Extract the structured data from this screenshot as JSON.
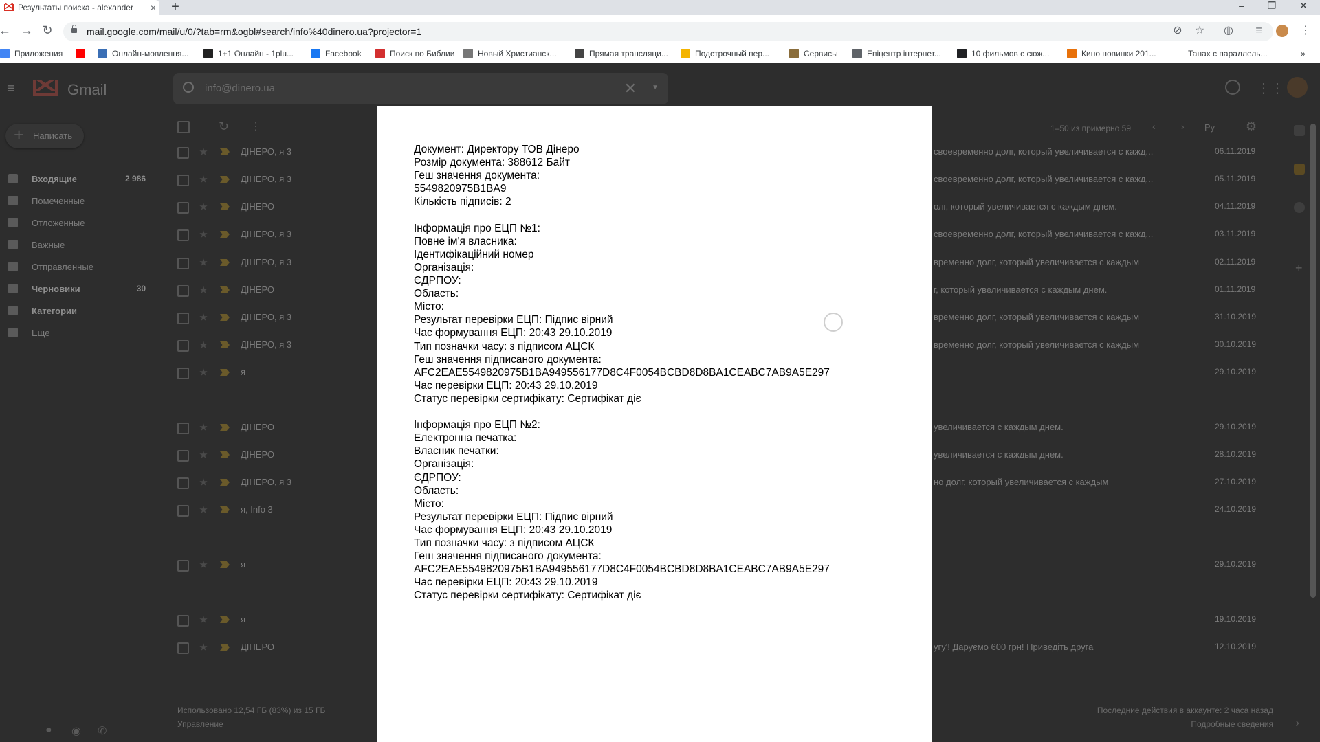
{
  "browser": {
    "tab_title": "Результаты поиска - alexander",
    "tab_close": "×",
    "new_tab": "+",
    "url": "mail.google.com/mail/u/0/?tab=rm&ogbl#search/info%40dinero.ua?projector=1",
    "bookmarks": [
      {
        "label": "Приложения",
        "color": "#4285f4"
      },
      {
        "label": "",
        "color": "#ff0000"
      },
      {
        "label": "Онлайн-мовлення...",
        "color": "#3b6fb5"
      },
      {
        "label": "1+1 Онлайн - 1plu...",
        "color": "#222222"
      },
      {
        "label": "Facebook",
        "color": "#1877f2"
      },
      {
        "label": "Поиск по Библии",
        "color": "#d32f2f"
      },
      {
        "label": "Новый Христианск...",
        "color": "#777777"
      },
      {
        "label": "Прямая трансляци...",
        "color": "#444444"
      },
      {
        "label": "Подстрочный пер...",
        "color": "#f4b400"
      },
      {
        "label": "Сервисы",
        "color": "#8a6d3b"
      },
      {
        "label": "Епіцентр інтернет...",
        "color": "#5f6368"
      },
      {
        "label": "10 фильмов с сюж...",
        "color": "#202124"
      },
      {
        "label": "Кино новинки 201...",
        "color": "#e8710a"
      },
      {
        "label": "Танах с параллель...",
        "color": "#ffffff"
      }
    ],
    "more_bookmarks": "»"
  },
  "gmail": {
    "app_name": "Gmail",
    "search_value": "info@dinero.ua",
    "compose": "Написать",
    "nav": [
      {
        "label": "Входящие",
        "count": "2 986",
        "bold": true
      },
      {
        "label": "Помеченные",
        "count": "",
        "bold": false
      },
      {
        "label": "Отложенные",
        "count": "",
        "bold": false
      },
      {
        "label": "Важные",
        "count": "",
        "bold": false
      },
      {
        "label": "Отправленные",
        "count": "",
        "bold": false
      },
      {
        "label": "Черновики",
        "count": "30",
        "bold": true
      },
      {
        "label": "Категории",
        "count": "",
        "bold": true
      },
      {
        "label": "Еще",
        "count": "",
        "bold": false
      }
    ],
    "pager": "1–50 из примерно 59",
    "lang": "Ру",
    "rows": [
      {
        "sender": "ДІНЕРО, я 3",
        "snippet": "своевременно долг, который увеличивается с кажд...",
        "date": "06.11.2019"
      },
      {
        "sender": "ДІНЕРО, я 3",
        "snippet": "своевременно долг, который увеличивается с кажд...",
        "date": "05.11.2019"
      },
      {
        "sender": "ДІНЕРО",
        "snippet": "олг, который увеличивается с каждым днем.",
        "date": "04.11.2019"
      },
      {
        "sender": "ДІНЕРО, я 3",
        "snippet": "своевременно долг, который увеличивается с кажд...",
        "date": "03.11.2019"
      },
      {
        "sender": "ДІНЕРО, я 3",
        "snippet": "временно долг, который увеличивается с каждым",
        "date": "02.11.2019"
      },
      {
        "sender": "ДІНЕРО",
        "snippet": "г, который увеличивается с каждым днем.",
        "date": "01.11.2019"
      },
      {
        "sender": "ДІНЕРО, я 3",
        "snippet": "временно долг, который увеличивается с каждым",
        "date": "31.10.2019"
      },
      {
        "sender": "ДІНЕРО, я 3",
        "snippet": "временно долг, который увеличивается с каждым",
        "date": "30.10.2019"
      },
      {
        "sender": "я",
        "snippet": "",
        "date": "29.10.2019"
      },
      {
        "sender": "ДІНЕРО",
        "snippet": "увеличивается с каждым днем.",
        "date": "29.10.2019"
      },
      {
        "sender": "ДІНЕРО",
        "snippet": "увеличивается с каждым днем.",
        "date": "28.10.2019"
      },
      {
        "sender": "ДІНЕРО, я 3",
        "snippet": "но долг, который увеличивается с каждым",
        "date": "27.10.2019"
      },
      {
        "sender": "я, Info 3",
        "snippet": "",
        "date": "24.10.2019"
      },
      {
        "sender": "я",
        "snippet": "",
        "date": "29.10.2019"
      },
      {
        "sender": "я",
        "snippet": "",
        "date": "19.10.2019"
      },
      {
        "sender": "ДІНЕРО",
        "snippet": "угу'! Даруємо 600 грн! Приведіть друга",
        "date": "12.10.2019"
      }
    ],
    "storage": "Использовано 12,54 ГБ (83%) из 15 ГБ",
    "manage": "Управление",
    "last_activity": "Последние действия в аккаунте: 2 часа назад",
    "details": "Подробные сведения"
  },
  "document": {
    "lines": [
      "Документ: Директору ТОВ Дінеро",
      "Розмір документа: 388612 Байт",
      "Геш значення документа:",
      "       5549820975B1BA9",
      "Кількість підписів: 2",
      "",
      "Інформація про ЕЦП №1:",
      "Повне ім'я власника: ",
      "Ідентифікаційний номер",
      "Організація:",
      "ЄДРПОУ:",
      "Область:",
      "Місто:",
      "Результат перевірки ЕЦП: Підпис вірний",
      "Час формування ЕЦП: 20:43 29.10.2019",
      "Тип позначки часу: з підписом АЦСК",
      "Геш значення підписаного документа:",
      "AFC2EAE5549820975B1BA949556177D8C4F0054BCBD8D8BA1CEABC7AB9A5E297",
      "Час перевірки ЕЦП: 20:43 29.10.2019",
      "Статус перевірки сертифікату: Сертифікат діє",
      "",
      "Інформація про ЕЦП №2:",
      "Електронна печатка:",
      "Власник печатки:",
      "Організація:",
      "ЄДРПОУ:",
      "Область:",
      "Місто:",
      "Результат перевірки ЕЦП: Підпис вірний",
      "Час формування ЕЦП: 20:43 29.10.2019",
      "Тип позначки часу: з підписом АЦСК",
      "Геш значення підписаного документа:",
      "AFC2EAE5549820975B1BA949556177D8C4F0054BCBD8D8BA1CEABC7AB9A5E297",
      "Час перевірки ЕЦП: 20:43 29.10.2019",
      "Статус перевірки сертифікату: Сертифікат діє"
    ]
  }
}
